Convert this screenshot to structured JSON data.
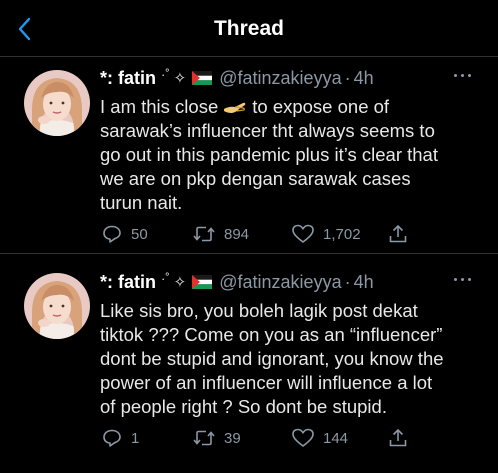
{
  "header": {
    "title": "Thread"
  },
  "colors": {
    "accent": "#1d9bf0",
    "muted": "#8b98a5",
    "background": "#000000"
  },
  "tweets": [
    {
      "display_name": "*: fatin",
      "decoration": "·˚",
      "sparkle": "✧",
      "handle": "@fatinzakieyya",
      "dot": "·",
      "time": "4h",
      "text_lines": [
        "I am this close",
        "to expose one of",
        "sarawak’s influencer tht always seems to",
        "go out in this pandemic plus it’s clear that",
        "we are on pkp dengan sarawak cases",
        "turun nait."
      ],
      "reply_count": "50",
      "retweet_count": "894",
      "like_count": "1,702"
    },
    {
      "display_name": "*: fatin",
      "decoration": "·˚",
      "sparkle": "✧",
      "handle": "@fatinzakieyya",
      "dot": "·",
      "time": "4h",
      "text_lines": [
        "Like sis bro, you boleh lagik post dekat",
        "tiktok ??? Come on you as an “influencer”",
        "dont be stupid and ignorant, you know the",
        "power of an influencer will influence a lot",
        "of people right ? So dont be stupid."
      ],
      "reply_count": "1",
      "retweet_count": "39",
      "like_count": "144"
    }
  ]
}
